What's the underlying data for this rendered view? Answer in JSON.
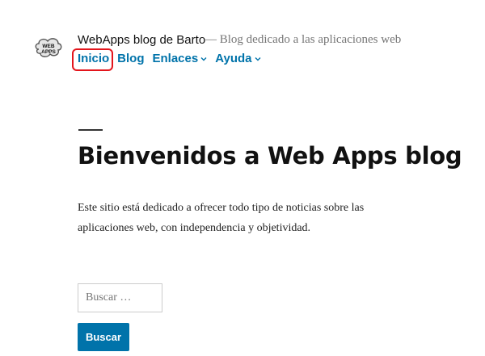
{
  "header": {
    "logo_text": "WEB APPS",
    "site_title": "WebApps blog de Barto",
    "tagline": "— Blog dedicado a las aplicaciones web"
  },
  "nav": {
    "items": [
      {
        "label": "Inicio",
        "has_dropdown": false,
        "highlighted": true
      },
      {
        "label": "Blog",
        "has_dropdown": false
      },
      {
        "label": "Enlaces",
        "has_dropdown": true
      },
      {
        "label": "Ayuda",
        "has_dropdown": true
      }
    ],
    "link_color": "#0073aa",
    "highlight_color": "#e3151c"
  },
  "main": {
    "title": "Bienvenidos a Web Apps blog",
    "intro": "Este sitio está dedicado a ofrecer todo tipo de noticias sobre las aplicaciones web, con independencia y objetividad."
  },
  "search": {
    "placeholder": "Buscar …",
    "button_label": "Buscar"
  }
}
